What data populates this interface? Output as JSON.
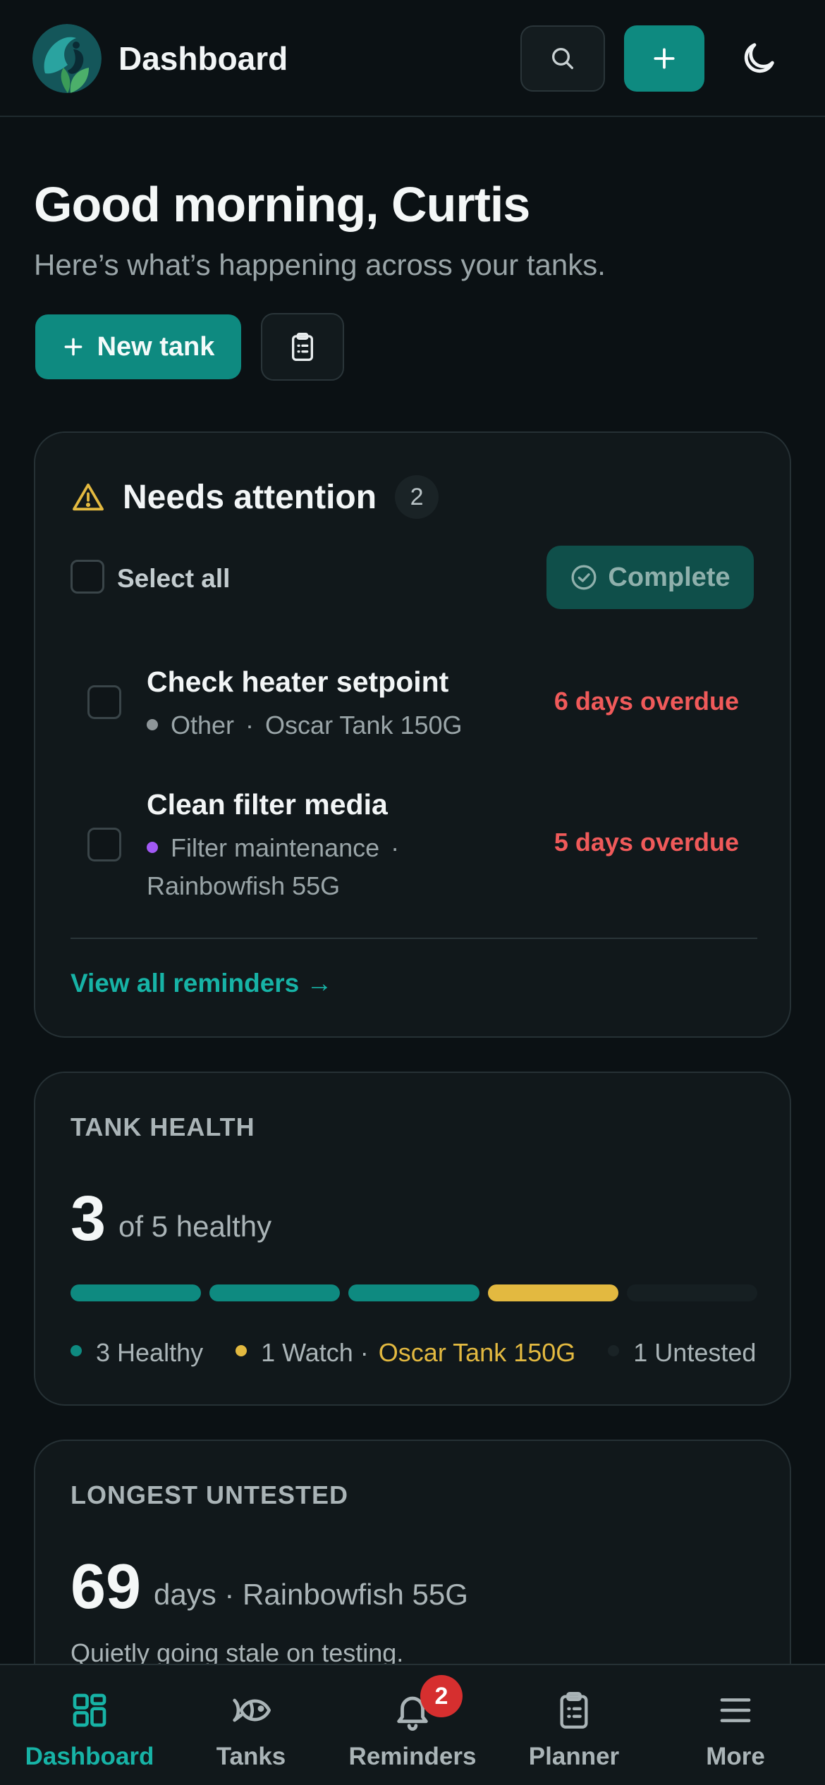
{
  "header": {
    "title": "Dashboard",
    "logo_icon": "fish-leaf-logo-icon",
    "search_icon": "search-icon",
    "add_icon": "plus-icon",
    "theme_icon": "moon-icon"
  },
  "hero": {
    "greeting": "Good morning, Curtis",
    "subtitle": "Here’s what’s happening across your tanks.",
    "new_tank_label": "New tank",
    "clipboard_icon": "clipboard-icon"
  },
  "attention": {
    "title": "Needs attention",
    "count": "2",
    "select_all_label": "Select all",
    "complete_label": "Complete",
    "tasks": [
      {
        "title": "Check heater setpoint",
        "category": "Other",
        "category_color": "#8e9699",
        "tank": "Oscar Tank 150G",
        "status": "6 days overdue"
      },
      {
        "title": "Clean filter media",
        "category": "Filter maintenance",
        "category_color": "#a259f5",
        "tank": "Rainbowfish 55G",
        "status": "5 days overdue"
      }
    ],
    "separator": "·",
    "view_all": "View all reminders →"
  },
  "tank_health": {
    "label": "TANK HEALTH",
    "healthy_count": "3",
    "suffix": "of 5 healthy",
    "segments": [
      {
        "status": "healthy",
        "color": "#0e8a80"
      },
      {
        "status": "healthy",
        "color": "#0e8a80"
      },
      {
        "status": "healthy",
        "color": "#0e8a80"
      },
      {
        "status": "watch",
        "color": "#e3b940"
      },
      {
        "status": "untested",
        "color": "#161f22"
      }
    ],
    "legend": {
      "healthy": "3 Healthy",
      "watch": "1 Watch ·",
      "watch_tank": "Oscar Tank 150G",
      "untested": "1 Untested"
    }
  },
  "longest_untested": {
    "label": "LONGEST UNTESTED",
    "days": "69",
    "suffix": "days · Rainbowfish 55G",
    "note": "Quietly going stale on testing."
  },
  "nav": {
    "items": [
      {
        "label": "Dashboard",
        "icon": "grid-icon",
        "active": true
      },
      {
        "label": "Tanks",
        "icon": "fish-icon"
      },
      {
        "label": "Reminders",
        "icon": "bell-icon",
        "badge": "2"
      },
      {
        "label": "Planner",
        "icon": "clipboard-list-icon"
      },
      {
        "label": "More",
        "icon": "menu-icon"
      }
    ]
  },
  "colors": {
    "accent": "#0e8a80",
    "accent_text": "#17b3a6",
    "danger": "#f05a5a",
    "warning": "#e3b940",
    "background": "#0b1114",
    "card": "#11181b"
  }
}
